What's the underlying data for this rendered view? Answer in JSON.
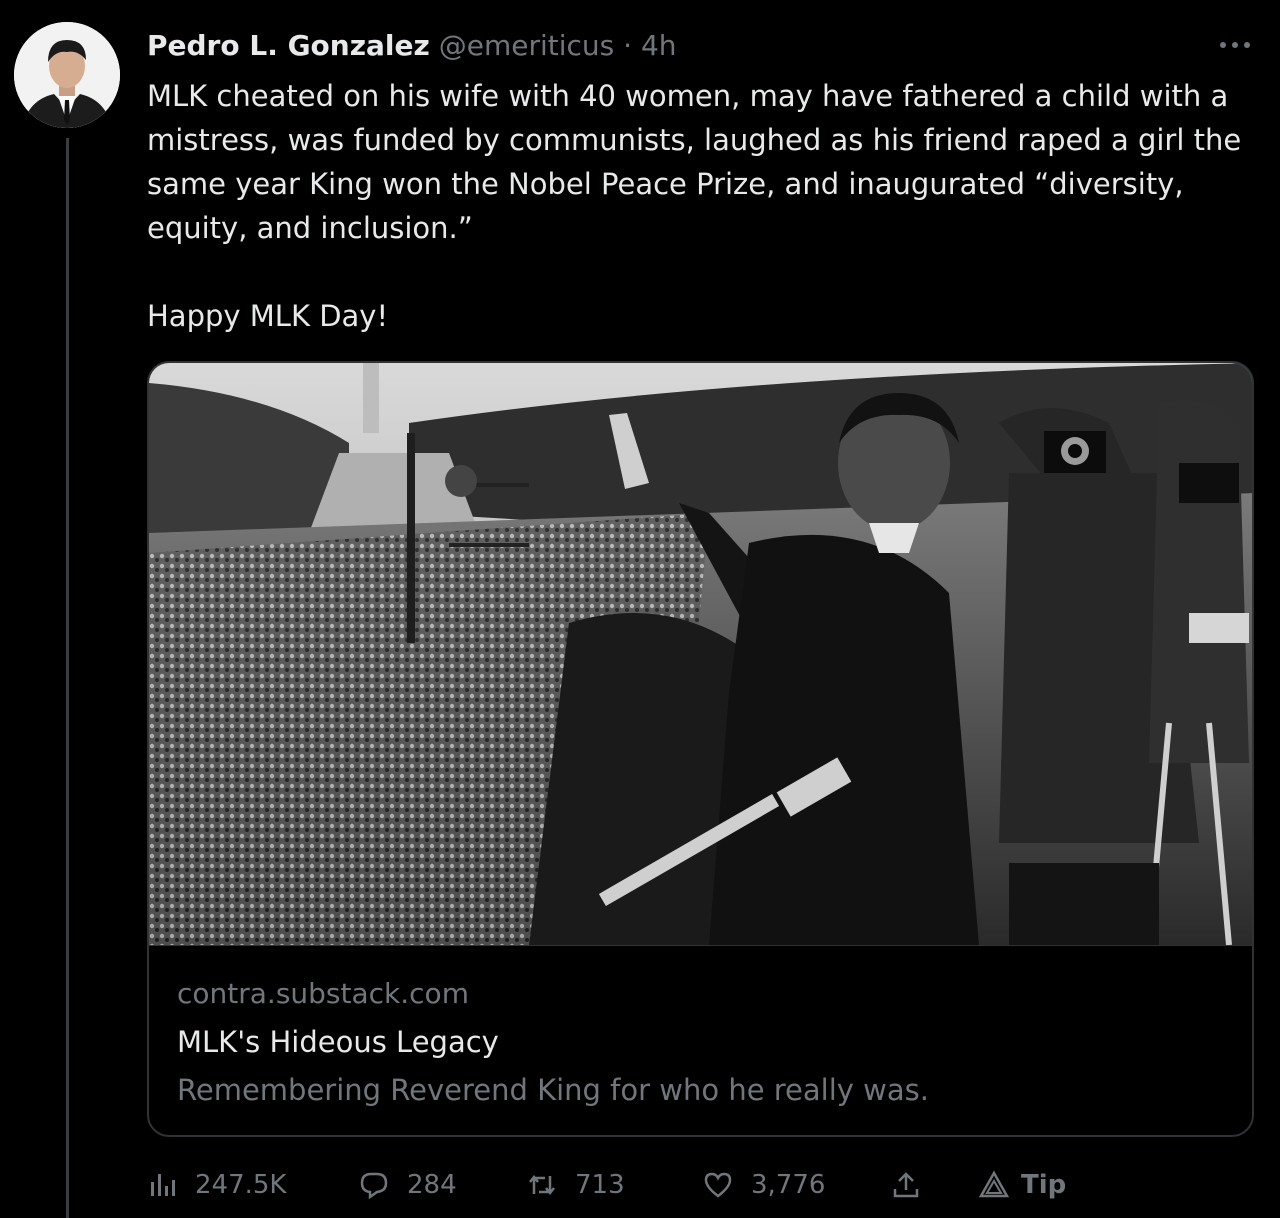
{
  "tweet": {
    "display_name": "Pedro L. Gonzalez",
    "handle": "@emeriticus",
    "separator": "·",
    "time": "4h",
    "more_icon": "more-horizontal-icon",
    "text_paragraphs": [
      "MLK cheated on his wife with 40 women, may have fathered a child with a mistress, was funded by communists, laughed as his friend raped a girl the same year King won the Nobel Peace Prize, and inaugurated “diversity, equity, and inclusion.”",
      "Happy MLK Day!"
    ]
  },
  "card": {
    "domain": "contra.substack.com",
    "title": "MLK's Hideous Legacy",
    "description": "Remembering Reverend King for who he really was."
  },
  "actions": {
    "views": {
      "icon": "analytics-icon",
      "count": "247.5K"
    },
    "reply": {
      "icon": "reply-icon",
      "count": "284"
    },
    "retweet": {
      "icon": "retweet-icon",
      "count": "713"
    },
    "like": {
      "icon": "heart-icon",
      "count": "3,776"
    },
    "share": {
      "icon": "share-icon"
    },
    "tip": {
      "icon": "tip-icon",
      "label": "Tip"
    }
  },
  "colors": {
    "background": "#000000",
    "primary_text": "#e7e9ea",
    "secondary_text": "#71767b",
    "border": "#2f3336"
  }
}
